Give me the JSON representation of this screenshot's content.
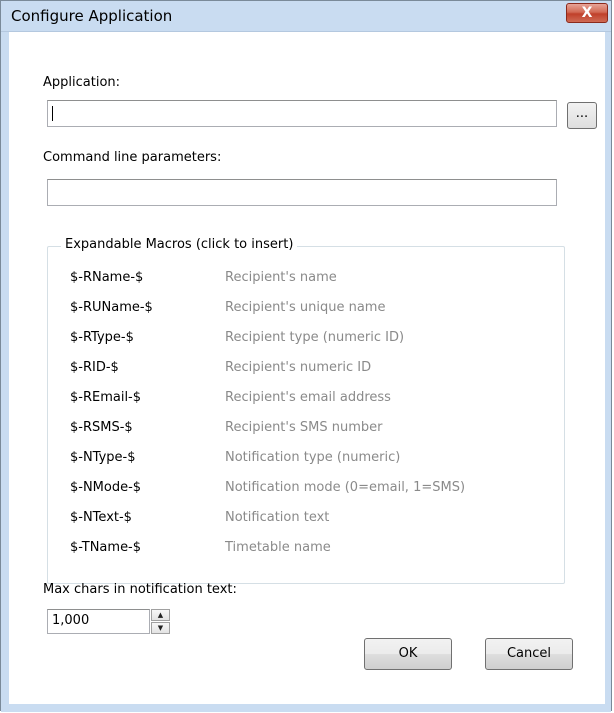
{
  "window": {
    "title": "Configure Application",
    "close_label": "X"
  },
  "application": {
    "label": "Application:",
    "value": "",
    "browse_label": "..."
  },
  "command_line": {
    "label": "Command line parameters:",
    "value": ""
  },
  "macros": {
    "group_label": "Expandable Macros (click to insert)",
    "items": [
      {
        "code": "$-RName-$",
        "desc": "Recipient's name"
      },
      {
        "code": "$-RUName-$",
        "desc": "Recipient's unique name"
      },
      {
        "code": "$-RType-$",
        "desc": "Recipient type (numeric ID)"
      },
      {
        "code": "$-RID-$",
        "desc": "Recipient's numeric ID"
      },
      {
        "code": "$-REmail-$",
        "desc": "Recipient's email address"
      },
      {
        "code": "$-RSMS-$",
        "desc": "Recipient's SMS number"
      },
      {
        "code": "$-NType-$",
        "desc": "Notification type (numeric)"
      },
      {
        "code": "$-NMode-$",
        "desc": "Notification mode (0=email, 1=SMS)"
      },
      {
        "code": "$-NText-$",
        "desc": "Notification text"
      },
      {
        "code": "$-TName-$",
        "desc": "Timetable name"
      }
    ]
  },
  "max_chars": {
    "label": "Max chars in notification text:",
    "value": "1,000"
  },
  "buttons": {
    "ok": "OK",
    "cancel": "Cancel"
  }
}
